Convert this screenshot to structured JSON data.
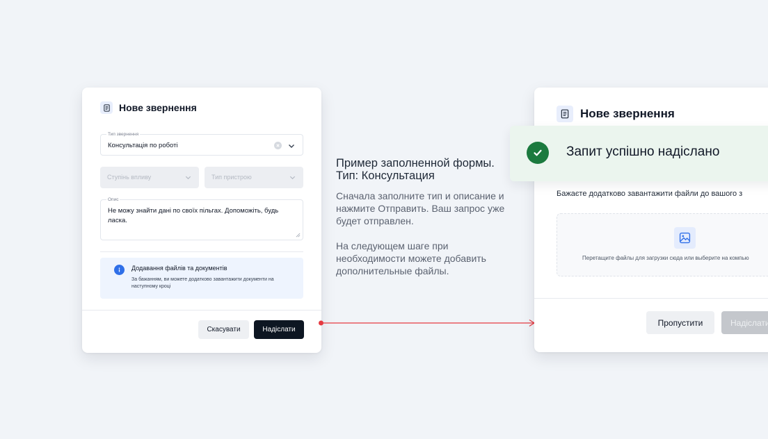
{
  "form": {
    "title": "Нове звернення",
    "type_field": {
      "label": "Тип звернення",
      "value": "Консультація по роботі"
    },
    "impact_select": {
      "placeholder": "Ступінь впливу"
    },
    "device_select": {
      "placeholder": "Тип пристрою"
    },
    "description": {
      "label": "Опис",
      "value": "Не можу знайти дані по своїх пільгах. Допоможіть, будь ласка."
    },
    "info": {
      "title": "Додавання файлів та документів",
      "text": "За бажанням, ви можете додатково завантажити документи на наступному кроці"
    },
    "cancel_label": "Скасувати",
    "submit_label": "Надіслати"
  },
  "caption": {
    "title": "Пример заполненной формы. Тип: Консультация",
    "paragraph1": "Сначала заполните тип и описание и нажмите Отправить. Ваш запрос уже будет отправлен.",
    "paragraph2": "На следующем шаге при необходимости можете добавить дополнительные файлы."
  },
  "step2": {
    "title": "Нове звернення",
    "toast": {
      "text": "Запит успішно надіслано",
      "icon": "check-circle-icon"
    },
    "upload_question": "Бажаєте додатково завантажити файли до вашого з",
    "dropzone_text": "Перетащите файлы для загрузки сюда или выберите на компью",
    "skip_label": "Пропустити",
    "submit_label": "Надіслати"
  },
  "colors": {
    "background": "#f1f4f8",
    "primary_button": "#0d1622",
    "info_accent": "#2f6fe8",
    "success": "#1b7a3e",
    "arrow": "#e53940"
  }
}
